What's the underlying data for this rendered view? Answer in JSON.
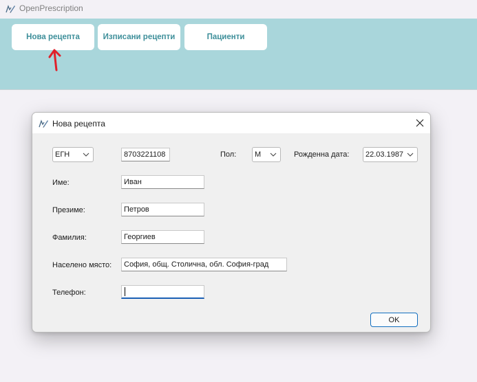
{
  "app": {
    "title": "OpenPrescription",
    "icon": "pen-prescription-icon"
  },
  "toolbar": {
    "buttons": [
      {
        "label": "Нова рецепта"
      },
      {
        "label": "Изписани рецепти"
      },
      {
        "label": "Пациенти"
      }
    ],
    "accent_color": "#a9d6db",
    "button_text_color": "#3e8f9a"
  },
  "annotation": {
    "arrow_color": "#e0202a"
  },
  "dialog": {
    "title": "Нова рецепта",
    "id_type": {
      "selected": "ЕГН"
    },
    "id_number": "8703221108",
    "sex": {
      "label": "Пол:",
      "selected": "М"
    },
    "birth_date": {
      "label": "Рожденна дата:",
      "value": "22.03.1987"
    },
    "first_name": {
      "label": "Име:",
      "value": "Иван"
    },
    "middle_name": {
      "label": "Презиме:",
      "value": "Петров"
    },
    "last_name": {
      "label": "Фамилия:",
      "value": "Георгиев"
    },
    "city": {
      "label": "Населено място:",
      "value": "София, общ. Столична, обл. София-град"
    },
    "phone": {
      "label": "Телефон:",
      "value": ""
    },
    "ok_label": "OK"
  }
}
